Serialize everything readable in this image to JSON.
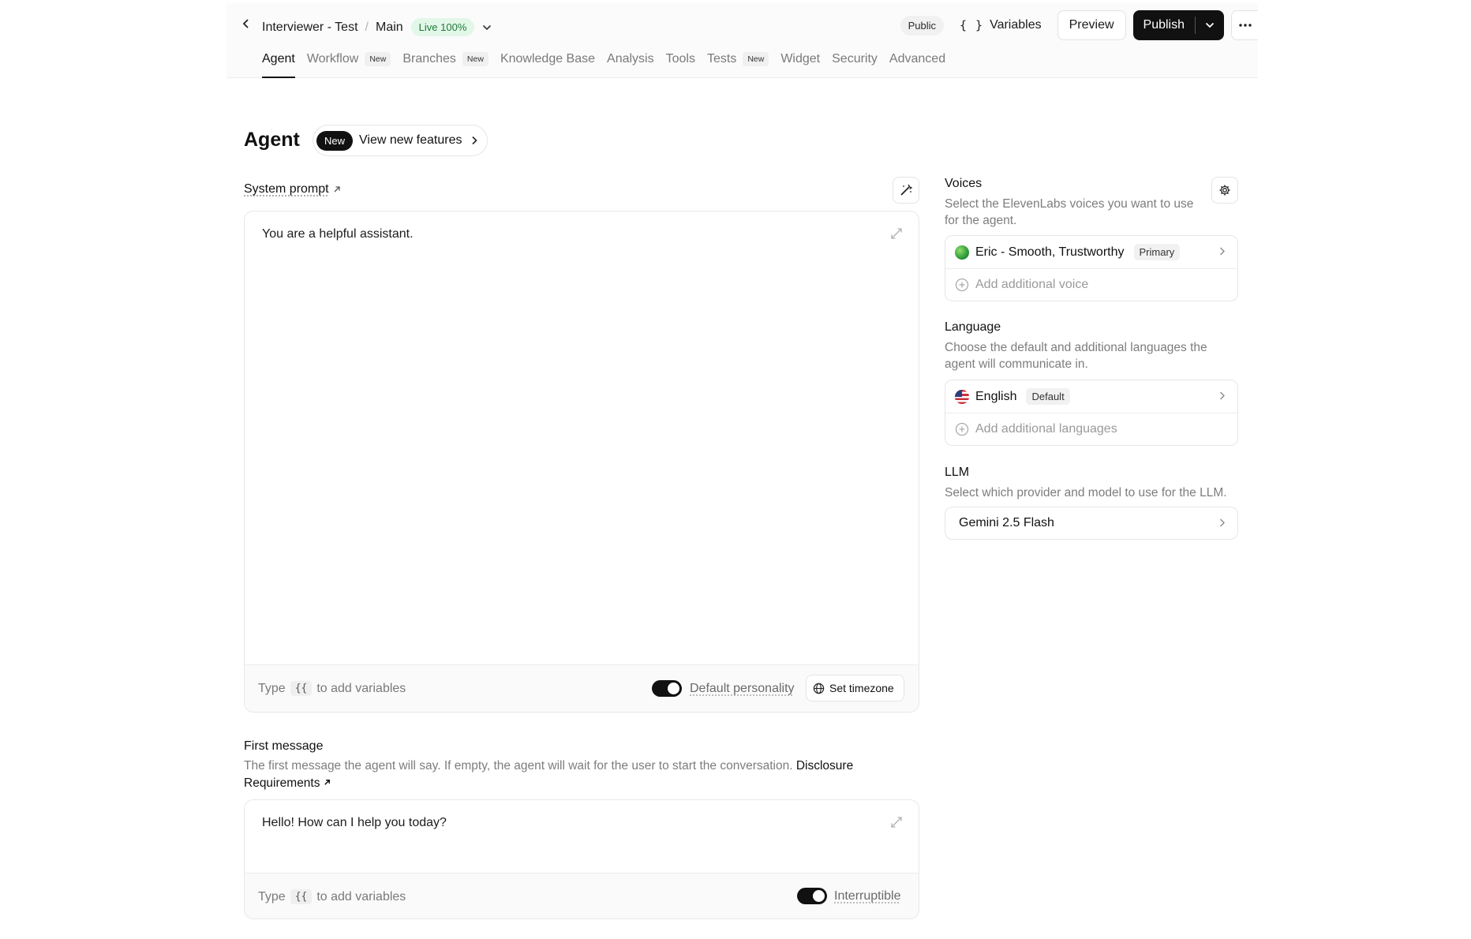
{
  "header": {
    "breadcrumb": {
      "project": "Interviewer - Test",
      "separator": "/",
      "branch": "Main"
    },
    "live_badge": "Live 100%",
    "public_badge": "Public",
    "variables_icon": "{ }",
    "variables_label": "Variables",
    "preview_label": "Preview",
    "publish_label": "Publish"
  },
  "tabs": [
    {
      "label": "Agent",
      "active": true
    },
    {
      "label": "Workflow",
      "badge": "New"
    },
    {
      "label": "Branches",
      "badge": "New"
    },
    {
      "label": "Knowledge Base"
    },
    {
      "label": "Analysis"
    },
    {
      "label": "Tools"
    },
    {
      "label": "Tests",
      "badge": "New"
    },
    {
      "label": "Widget"
    },
    {
      "label": "Security"
    },
    {
      "label": "Advanced"
    }
  ],
  "page": {
    "title": "Agent",
    "features_badge": "New",
    "features_label": "View new features"
  },
  "system_prompt": {
    "label": "System prompt",
    "value": "You are a helpful assistant.",
    "hint_prefix": "Type",
    "hint_code": "{{",
    "hint_suffix": "to add variables",
    "personality_label": "Default personality",
    "personality_on": true,
    "timezone_label": "Set timezone"
  },
  "first_message": {
    "label": "First message",
    "description": "The first message the agent will say. If empty, the agent will wait for the user to start the conversation.",
    "link_text": "Disclosure Requirements",
    "value": "Hello! How can I help you today?",
    "hint_prefix": "Type",
    "hint_code": "{{",
    "hint_suffix": "to add variables",
    "interruptible_label": "Interruptible",
    "interruptible_on": true
  },
  "voices": {
    "title": "Voices",
    "description": "Select the ElevenLabs voices you want to use for the agent.",
    "items": [
      {
        "name": "Eric - Smooth, Trustworthy",
        "badge": "Primary"
      }
    ],
    "add_label": "Add additional voice"
  },
  "language": {
    "title": "Language",
    "description": "Choose the default and additional languages the agent will communicate in.",
    "items": [
      {
        "name": "English",
        "badge": "Default"
      }
    ],
    "add_label": "Add additional languages"
  },
  "llm": {
    "title": "LLM",
    "description": "Select which provider and model to use for the LLM.",
    "model": "Gemini 2.5 Flash"
  },
  "colors": {
    "accent": "#111111",
    "live_bg": "#e3f7e8",
    "live_text": "#1f7a3a"
  }
}
